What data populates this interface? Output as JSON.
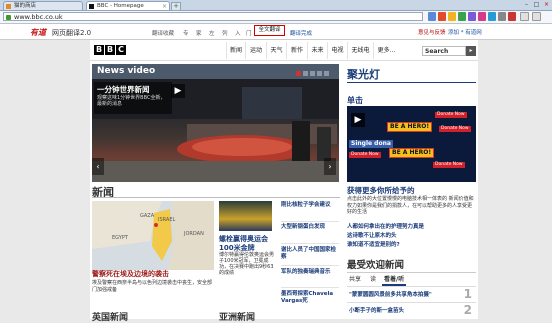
{
  "browser": {
    "tabs": [
      {
        "label": "猫的商店",
        "active": false
      },
      {
        "label": "BBC - Homepage",
        "active": true
      }
    ],
    "new_tab": "+",
    "window_controls": [
      "–",
      "□",
      "×"
    ],
    "url": "www.bbc.co.uk"
  },
  "translator": {
    "brand": "有道",
    "brand_text": "网页翻译2.0",
    "links": [
      "翻译收藏",
      "专",
      "家",
      "左",
      "列",
      "入",
      "门"
    ],
    "full_translate": "全文翻译",
    "right_links": [
      "翻译完成"
    ],
    "hint": "意见与反馈",
    "hint2": "添加 * 有道网"
  },
  "bbc": {
    "logo": [
      "B",
      "B",
      "C"
    ],
    "nav": [
      "新闻",
      "运动",
      "天气",
      "新作",
      "未来",
      "电视",
      "无线电",
      "更多..."
    ],
    "search_placeholder": "Search",
    "search_btn": "▸"
  },
  "news_video": {
    "title": "News video",
    "caption_title": "一分钟世界新闻",
    "caption_sub": "观察这味1分钟世界BBC全新，最新的消息",
    "play": "▶",
    "prev": "‹",
    "next": "›"
  },
  "news": {
    "title": "新闻",
    "map_labels": [
      "ISRAEL",
      "EGYPT",
      "JORDAN",
      "GAZA"
    ],
    "story1_title": "警察死在埃及边境的袭击",
    "story1_summary": "埃及警察在西奈半岛与以色列边境袭击中丧生，安全部门加强戒备",
    "story2_title": "螺栓赢得奥运会100米金牌",
    "story2_summary": "博尔特赢得伦敦奥运会男子100米冠军，卫冕成功，在决赛中跑出9秒63的成绩",
    "side_heads": [
      "刚比核粒子学会建议",
      "大型新钢蛋白发现",
      "谢比人员了中国国家检察",
      "军队的独奏瑞典音乐",
      "墨西哥探索Chavela Vargas死"
    ],
    "bottom_left": "英国新闻",
    "bottom_right": "亚洲新闻"
  },
  "spotlight": {
    "title": "聚光灯",
    "subtitle": "单击",
    "hero_text": "BE A HERO!",
    "donate_text": "Donate Now",
    "single_text": "Single dona",
    "play": "▶",
    "headline": "获得更多你所给予的",
    "summary": "点击此外的大位置慢慢的电脑技术相一体表的 新闻价值和权力如果你是我们的捐款人，在可以帮助更多的人享受更好的生活",
    "links": [
      "人都如何拿出在的护理努力真是",
      "这诗歌不让原木的头",
      "谁知道不适宜是别的?"
    ]
  },
  "most_popular": {
    "title": "最受欢迎新闻",
    "tabs": [
      "共享",
      "读",
      "看着/听"
    ],
    "items": [
      {
        "text": "\"蒙蒙圆圆风景前多共享角本拍摄\"",
        "rank": "1"
      },
      {
        "text": "小断手子的斯一盒苗头",
        "rank": "2"
      }
    ]
  }
}
